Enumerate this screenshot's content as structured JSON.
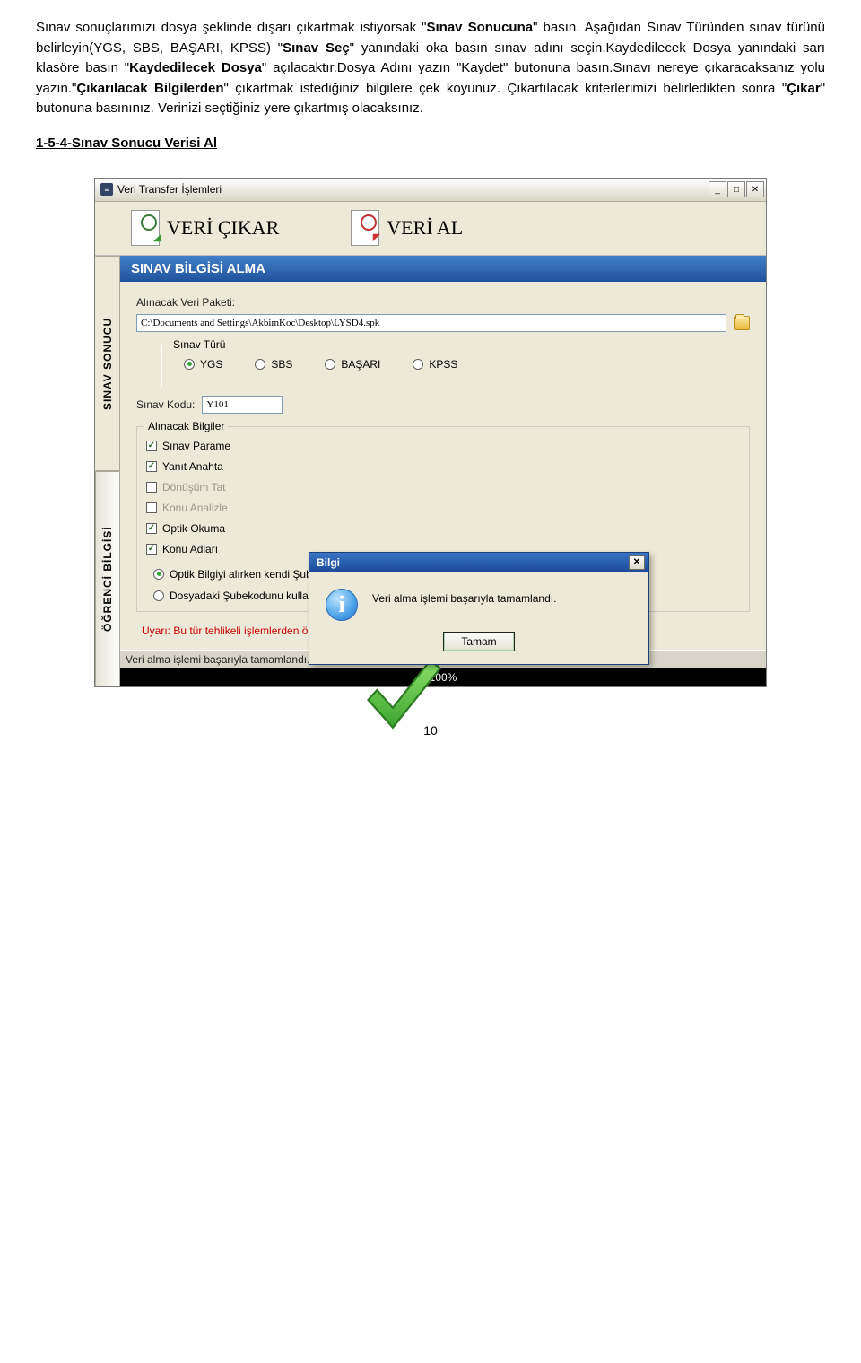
{
  "intro_paragraph_parts": {
    "p1a": "Sınav sonuçlarımızı dosya şeklinde dışarı çıkartmak istiyorsak \"",
    "p1b": "Sınav Sonucuna",
    "p1c": "\" basın. Aşağıdan Sınav Türünden sınav türünü belirleyin(YGS, SBS, BAŞARI, KPSS) \"",
    "p1d": "Sınav Seç",
    "p1e": "\" yanındaki oka basın sınav adını seçin.Kaydedilecek Dosya yanındaki sarı klasöre basın \"",
    "p1f": "Kaydedilecek Dosya",
    "p1g": "\" açılacaktır.Dosya Adını yazın \"Kaydet\" butonuna basın.Sınavı nereye çıkaracaksanız yolu yazın.\"",
    "p1h": "Çıkarılacak Bilgilerden",
    "p1i": "\" çıkartmak istediğiniz bilgilere çek koyunuz. Çıkartılacak kriterlerimizi belirledikten sonra \"",
    "p1j": "Çıkar",
    "p1k": "\" butonuna basınınız. Verinizi seçtiğiniz yere çıkartmış olacaksınız."
  },
  "section_title": "1-5-4-Sınav Sonucu Verisi Al",
  "window": {
    "title": "Veri Transfer İşlemleri",
    "tabs": {
      "cikar": "VERİ ÇIKAR",
      "al": "VERİ AL"
    },
    "panel_title": "SINAV BİLGİSİ ALMA",
    "side": {
      "top": "SINAV SONUCU",
      "bottom": "ÖĞRENCİ BİLGİSİ"
    },
    "fields": {
      "paket_label": "Alınacak Veri Paketi:",
      "paket_value": "C:\\Documents and Settings\\AkbimKoc\\Desktop\\LYSD4.spk",
      "sinav_turu_label": "Sınav Türü",
      "radios": {
        "ygs": "YGS",
        "sbs": "SBS",
        "basari": "BAŞARI",
        "kpss": "KPSS"
      },
      "sinav_kodu_label": "Sınav Kodu:",
      "sinav_kodu_value": "Y101",
      "alinacak_title": "Alınacak Bilgiler",
      "checks": {
        "c1": "Sınav Parame",
        "c2": "Yanıt Anahta",
        "c3": "Dönüşüm Tat",
        "c4": "Konu Analizle",
        "c5": "Optik Okuma",
        "c6": "Konu Adları"
      },
      "r1": "Optik Bilgiyi alırken kendi Şubekodunu kullan",
      "r2": "Dosyadaki Şubekodunu kullan"
    },
    "warning": "Uyarı: Bu tür tehlikeli işlemlerden önce yedek almanızı öneririz.",
    "status": "Veri alma işlemi başarıyla tamamlandı.",
    "progress": "100%"
  },
  "modal": {
    "title": "Bilgi",
    "text": "Veri alma işlemi başarıyla tamamlandı.",
    "ok": "Tamam"
  },
  "page_number": "10"
}
